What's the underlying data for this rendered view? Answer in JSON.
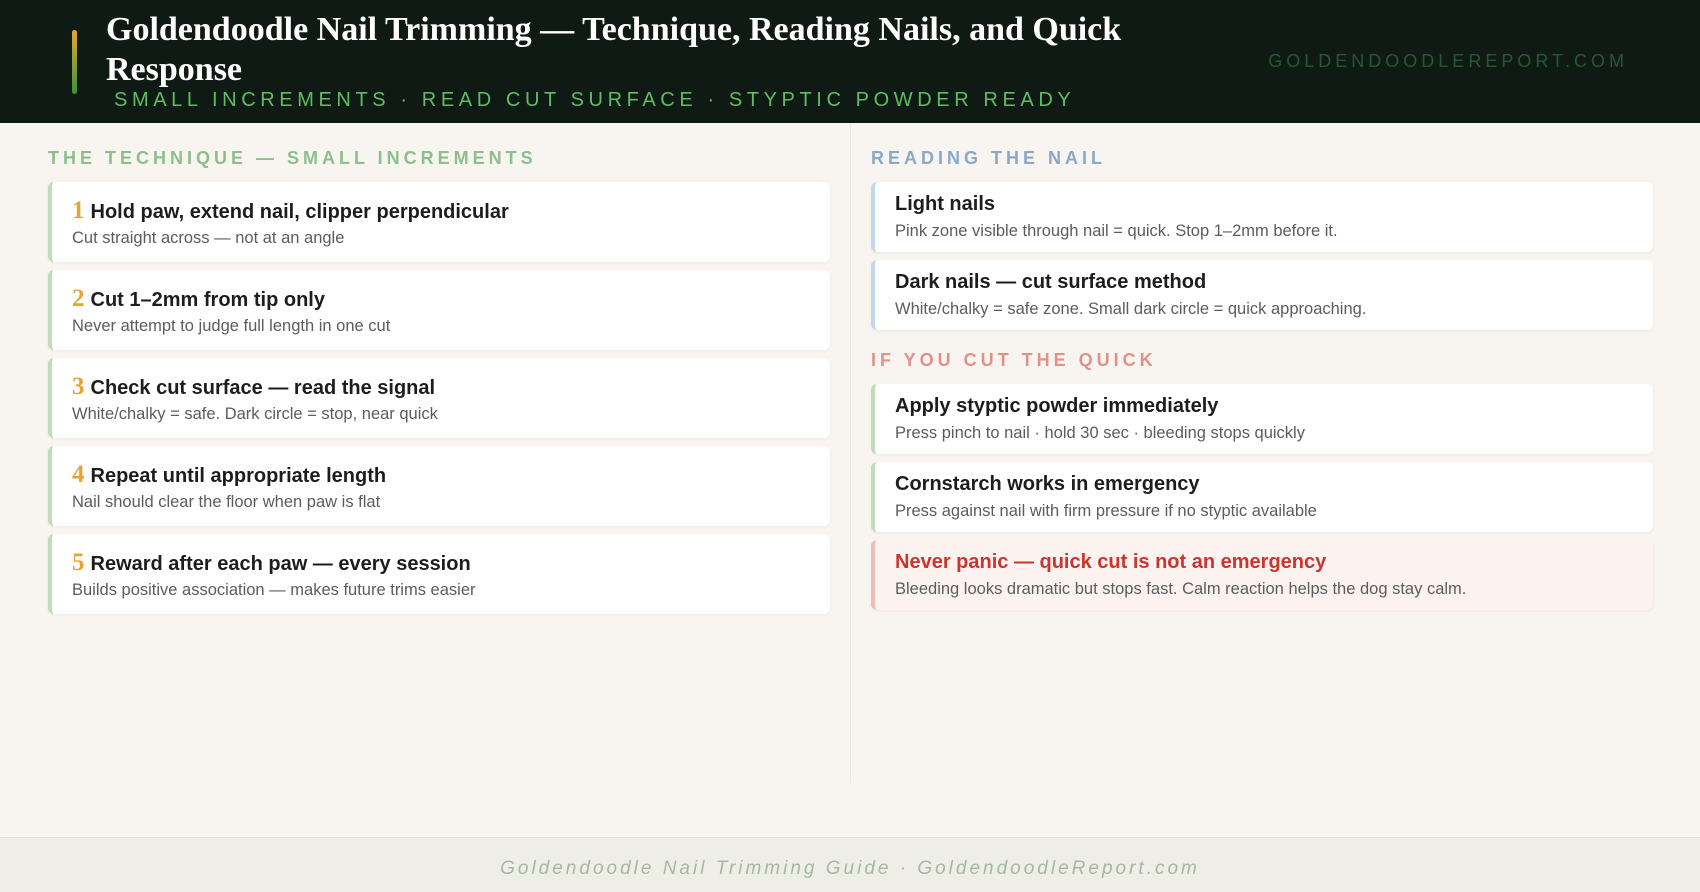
{
  "header": {
    "title": "Goldendoodle Nail Trimming — Technique, Reading Nails, and Quick Response",
    "subtitle": "SMALL INCREMENTS · READ CUT SURFACE · STYPTIC POWDER READY",
    "site": "GOLDENDOODLEREPORT.COM"
  },
  "technique": {
    "heading": "THE TECHNIQUE — SMALL INCREMENTS",
    "steps": [
      {
        "num": "1",
        "title": "Hold paw, extend nail, clipper perpendicular",
        "desc": "Cut straight across — not at an angle"
      },
      {
        "num": "2",
        "title": "Cut 1–2mm from tip only",
        "desc": "Never attempt to judge full length in one cut"
      },
      {
        "num": "3",
        "title": "Check cut surface — read the signal",
        "desc": "White/chalky = safe. Dark circle = stop, near quick"
      },
      {
        "num": "4",
        "title": "Repeat until appropriate length",
        "desc": "Nail should clear the floor when paw is flat"
      },
      {
        "num": "5",
        "title": "Reward after each paw — every session",
        "desc": "Builds positive association — makes future trims easier"
      }
    ]
  },
  "reading": {
    "heading": "READING THE NAIL",
    "items": [
      {
        "title": "Light nails",
        "desc": "Pink zone visible through nail = quick. Stop 1–2mm before it."
      },
      {
        "title": "Dark nails — cut surface method",
        "desc": "White/chalky = safe zone. Small dark circle = quick approaching."
      }
    ]
  },
  "quick": {
    "heading": "IF YOU CUT THE QUICK",
    "items": [
      {
        "title": "Apply styptic powder immediately",
        "desc": "Press pinch to nail · hold 30 sec · bleeding stops quickly"
      },
      {
        "title": "Cornstarch works in emergency",
        "desc": "Press against nail with firm pressure if no styptic available"
      },
      {
        "title": "Never panic — quick cut is not an emergency",
        "desc": "Bleeding looks dramatic but stops fast. Calm reaction helps the dog stay calm."
      }
    ]
  },
  "footer": {
    "text": "Goldendoodle Nail Trimming Guide · GoldendoodleReport.com"
  },
  "colors": {
    "header_bg": "#101a14",
    "subtitle_green": "#5fbd63",
    "step_number": "#e5a532",
    "warning_red": "#c8362d"
  }
}
